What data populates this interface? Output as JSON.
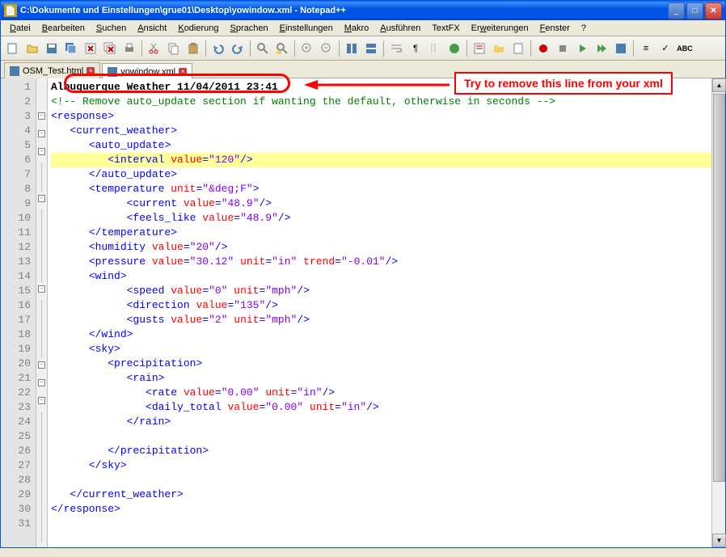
{
  "titlebar": {
    "path": "C:\\Dokumente und Einstellungen\\grue01\\Desktop\\yowindow.xml - Notepad++"
  },
  "menu": {
    "items": [
      {
        "label": "Datei",
        "u": 0
      },
      {
        "label": "Bearbeiten",
        "u": 0
      },
      {
        "label": "Suchen",
        "u": 0
      },
      {
        "label": "Ansicht",
        "u": 0
      },
      {
        "label": "Kodierung",
        "u": 0
      },
      {
        "label": "Sprachen",
        "u": 0
      },
      {
        "label": "Einstellungen",
        "u": 0
      },
      {
        "label": "Makro",
        "u": 0
      },
      {
        "label": "Ausführen",
        "u": 0
      },
      {
        "label": "TextFX",
        "u": -1
      },
      {
        "label": "Erweiterungen",
        "u": 2
      },
      {
        "label": "Fenster",
        "u": 0
      },
      {
        "label": "?",
        "u": -1
      }
    ]
  },
  "tabs": [
    {
      "label": "OSM_Test.html",
      "active": false
    },
    {
      "label": "yowindow.xml",
      "active": true
    }
  ],
  "annotation": {
    "callout": "Try to remove this line from your xml"
  },
  "code": {
    "lines": [
      {
        "n": 1,
        "fold": "",
        "hl": false,
        "indent": 0,
        "type": "plain",
        "text": "Albuquerque Weather 11/04/2011 23:41"
      },
      {
        "n": 2,
        "fold": "",
        "hl": false,
        "indent": 0,
        "type": "comment",
        "text": "<!-- Remove auto_update section if wanting the default, otherwise in seconds -->"
      },
      {
        "n": 3,
        "fold": "box",
        "hl": false,
        "indent": 0,
        "type": "open",
        "tag": "response",
        "attrs": []
      },
      {
        "n": 4,
        "fold": "box",
        "hl": false,
        "indent": 1,
        "type": "open",
        "tag": "current_weather",
        "attrs": []
      },
      {
        "n": 5,
        "fold": "box",
        "hl": false,
        "indent": 2,
        "type": "open",
        "tag": "auto_update",
        "attrs": []
      },
      {
        "n": 6,
        "fold": "line",
        "hl": true,
        "indent": 3,
        "type": "self",
        "tag": "interval",
        "attrs": [
          {
            "k": "value",
            "v": "120"
          }
        ]
      },
      {
        "n": 7,
        "fold": "line",
        "hl": false,
        "indent": 2,
        "type": "close",
        "tag": "auto_update"
      },
      {
        "n": 8,
        "fold": "box",
        "hl": false,
        "indent": 2,
        "type": "open",
        "tag": "temperature",
        "attrs": [
          {
            "k": "unit",
            "v": "&deg;F"
          }
        ]
      },
      {
        "n": 9,
        "fold": "line",
        "hl": false,
        "indent": 4,
        "type": "self",
        "tag": "current",
        "attrs": [
          {
            "k": "value",
            "v": "48.9"
          }
        ]
      },
      {
        "n": 10,
        "fold": "line",
        "hl": false,
        "indent": 4,
        "type": "self",
        "tag": "feels_like",
        "attrs": [
          {
            "k": "value",
            "v": "48.9"
          }
        ]
      },
      {
        "n": 11,
        "fold": "line",
        "hl": false,
        "indent": 2,
        "type": "close",
        "tag": "temperature"
      },
      {
        "n": 12,
        "fold": "line",
        "hl": false,
        "indent": 2,
        "type": "self",
        "tag": "humidity",
        "attrs": [
          {
            "k": "value",
            "v": "20"
          }
        ]
      },
      {
        "n": 13,
        "fold": "line",
        "hl": false,
        "indent": 2,
        "type": "self",
        "tag": "pressure",
        "attrs": [
          {
            "k": "value",
            "v": "30.12"
          },
          {
            "k": "unit",
            "v": "in"
          },
          {
            "k": "trend",
            "v": "-0.01"
          }
        ]
      },
      {
        "n": 14,
        "fold": "box",
        "hl": false,
        "indent": 2,
        "type": "open",
        "tag": "wind",
        "attrs": []
      },
      {
        "n": 15,
        "fold": "line",
        "hl": false,
        "indent": 4,
        "type": "self",
        "tag": "speed",
        "attrs": [
          {
            "k": "value",
            "v": "0"
          },
          {
            "k": "unit",
            "v": "mph"
          }
        ]
      },
      {
        "n": 16,
        "fold": "line",
        "hl": false,
        "indent": 4,
        "type": "self",
        "tag": "direction",
        "attrs": [
          {
            "k": "value",
            "v": "135"
          }
        ]
      },
      {
        "n": 17,
        "fold": "line",
        "hl": false,
        "indent": 4,
        "type": "self",
        "tag": "gusts",
        "attrs": [
          {
            "k": "value",
            "v": "2"
          },
          {
            "k": "unit",
            "v": "mph"
          }
        ]
      },
      {
        "n": 18,
        "fold": "line",
        "hl": false,
        "indent": 2,
        "type": "close",
        "tag": "wind"
      },
      {
        "n": 19,
        "fold": "box",
        "hl": false,
        "indent": 2,
        "type": "open",
        "tag": "sky",
        "attrs": []
      },
      {
        "n": 20,
        "fold": "box",
        "hl": false,
        "indent": 3,
        "type": "open",
        "tag": "precipitation",
        "attrs": []
      },
      {
        "n": 21,
        "fold": "box",
        "hl": false,
        "indent": 4,
        "type": "open",
        "tag": "rain",
        "attrs": []
      },
      {
        "n": 22,
        "fold": "line",
        "hl": false,
        "indent": 5,
        "type": "self",
        "tag": "rate",
        "attrs": [
          {
            "k": "value",
            "v": "0.00"
          },
          {
            "k": "unit",
            "v": "in"
          }
        ]
      },
      {
        "n": 23,
        "fold": "line",
        "hl": false,
        "indent": 5,
        "type": "self",
        "tag": "daily_total",
        "attrs": [
          {
            "k": "value",
            "v": "0.00"
          },
          {
            "k": "unit",
            "v": "in"
          }
        ]
      },
      {
        "n": 24,
        "fold": "line",
        "hl": false,
        "indent": 4,
        "type": "close",
        "tag": "rain"
      },
      {
        "n": 25,
        "fold": "line",
        "hl": false,
        "indent": 0,
        "type": "blank"
      },
      {
        "n": 26,
        "fold": "line",
        "hl": false,
        "indent": 3,
        "type": "close",
        "tag": "precipitation"
      },
      {
        "n": 27,
        "fold": "line",
        "hl": false,
        "indent": 2,
        "type": "close",
        "tag": "sky"
      },
      {
        "n": 28,
        "fold": "line",
        "hl": false,
        "indent": 0,
        "type": "blank"
      },
      {
        "n": 29,
        "fold": "line",
        "hl": false,
        "indent": 1,
        "type": "close",
        "tag": "current_weather"
      },
      {
        "n": 30,
        "fold": "line",
        "hl": false,
        "indent": 0,
        "type": "close",
        "tag": "response"
      },
      {
        "n": 31,
        "fold": "",
        "hl": false,
        "indent": 0,
        "type": "blank"
      }
    ]
  }
}
